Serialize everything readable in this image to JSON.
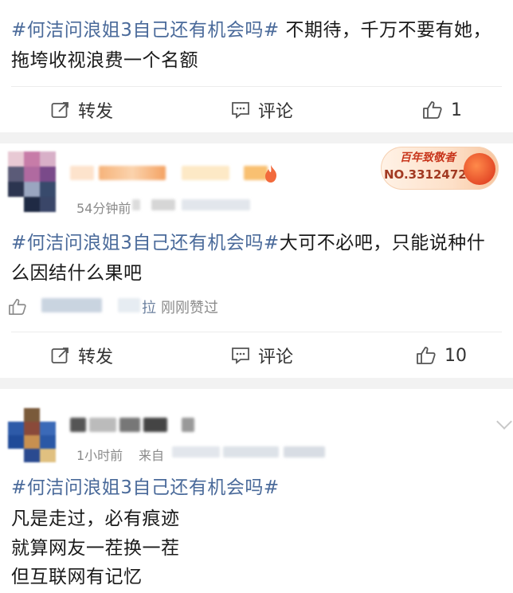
{
  "post1": {
    "topic": "#何洁问浪姐3自己还有机会吗#",
    "body": " 不期待，千万不要有她，",
    "body2": "拖垮收视浪费一个名额",
    "forward": "转发",
    "comment": "评论",
    "likes": "1"
  },
  "post2": {
    "time": "54分钟前",
    "badge_title": "百年致敬者",
    "badge_no": "NO.3312472",
    "topic": "#何洁问浪姐3自己还有机会吗#",
    "body": "大可不必吧，只能说种什",
    "body2": "么因结什么果吧",
    "liked_by_suffix": "拉",
    "liked_text": "刚刚赞过",
    "forward": "转发",
    "comment": "评论",
    "likes": "10"
  },
  "post3": {
    "time": "1小时前",
    "from": "来自",
    "topic": "#何洁问浪姐3自己还有机会吗#",
    "lines": [
      "凡是走过，必有痕迹",
      "就算网友一茬换一茬",
      "但互联网有记忆"
    ]
  },
  "colors": {
    "topic": "#4a6a9a",
    "separator": "#f2f2f2",
    "meta": "#8a8a8a"
  }
}
